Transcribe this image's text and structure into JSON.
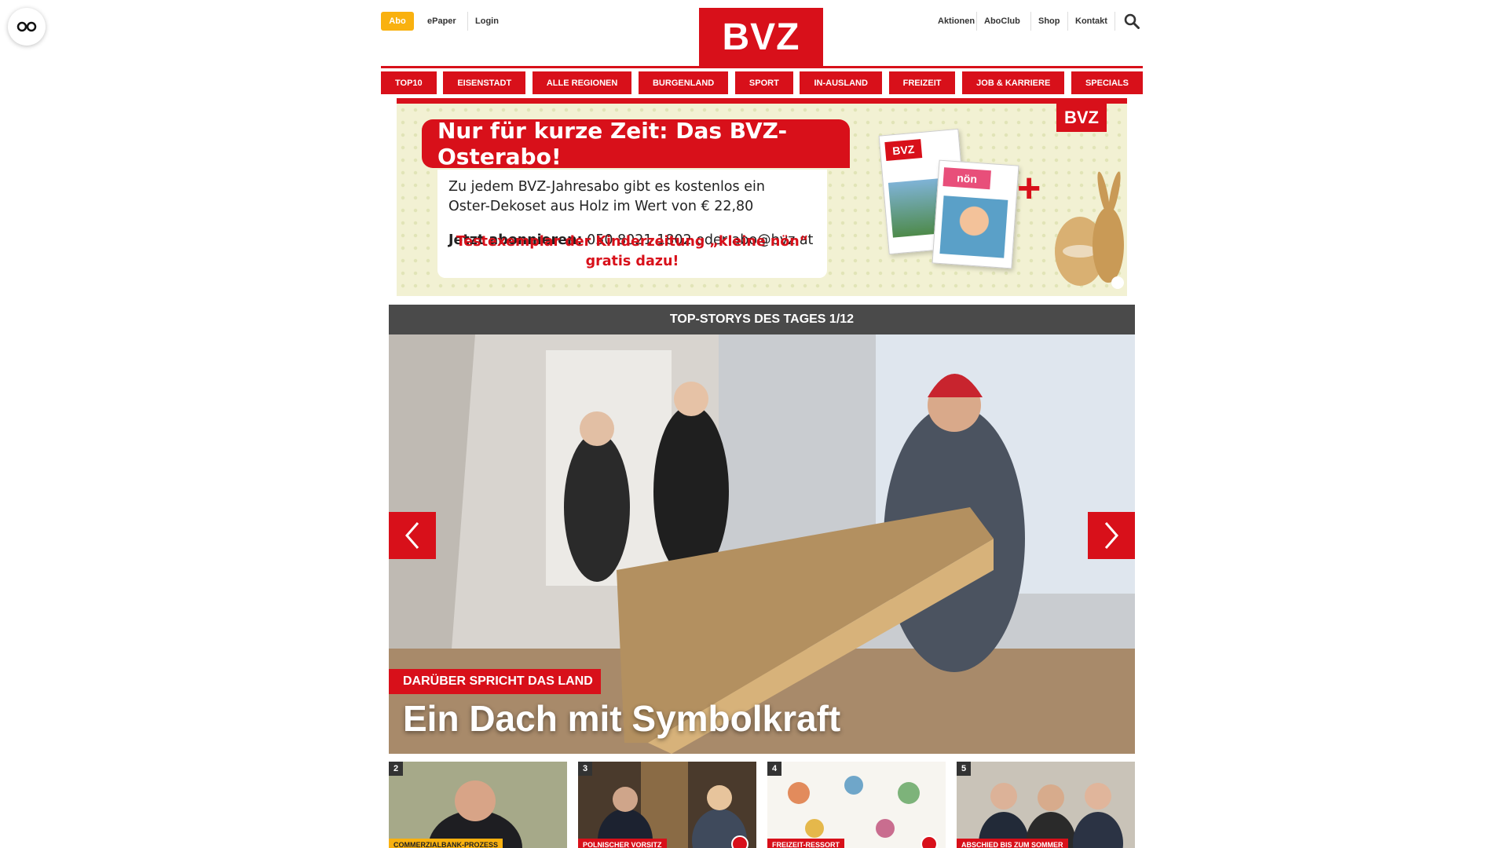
{
  "accessibility": {
    "icon": "accessibility-toggle-icon"
  },
  "topbar": {
    "abo_label": "Abo",
    "links_left": [
      "ePaper",
      "Login"
    ],
    "logo_text": "BVZ",
    "links_right": [
      "Aktionen",
      "AboClub",
      "Shop",
      "Kontakt"
    ],
    "search_icon": "search-icon"
  },
  "nav": {
    "items": [
      "TOP10",
      "EISENSTADT",
      "ALLE REGIONEN",
      "BURGENLAND",
      "SPORT",
      "IN-AUSLAND",
      "FREIZEIT",
      "JOB & KARRIERE",
      "SPECIALS"
    ]
  },
  "banner": {
    "headline": "Nur für kurze Zeit: Das BVZ-Osterabo!",
    "line1": "Zu jedem BVZ-Jahresabo gibt es kostenlos ein",
    "line2": "Oster-Dekoset aus Holz im Wert von € 22,80",
    "cta_bold": "Jetzt abonnieren:",
    "cta_rest": " 050 8021 1802 oder abo@bvz.at",
    "red_line": "Testexemplar der Kinderzeitung „kleine nön“ gratis dazu!",
    "logo_text": "BVZ",
    "mag1_logo": "BVZ",
    "mag2_logo": "nön"
  },
  "carousel": {
    "title": "TOP-STORYS DES TAGES 1/12",
    "kicker": "DARÜBER SPRICHT DAS LAND",
    "headline": "Ein Dach mit Symbolkraft",
    "prev_icon": "chevron-left-icon",
    "next_icon": "chevron-right-icon"
  },
  "thumbs": [
    {
      "num": "2",
      "tag": "COMMERZIALBANK-PROZESS"
    },
    {
      "num": "3",
      "tag": "POLNISCHER VORSITZ"
    },
    {
      "num": "4",
      "tag": "FREIZEIT-RESSORT"
    },
    {
      "num": "5",
      "tag": "ABSCHIED BIS ZUM SOMMER"
    }
  ]
}
